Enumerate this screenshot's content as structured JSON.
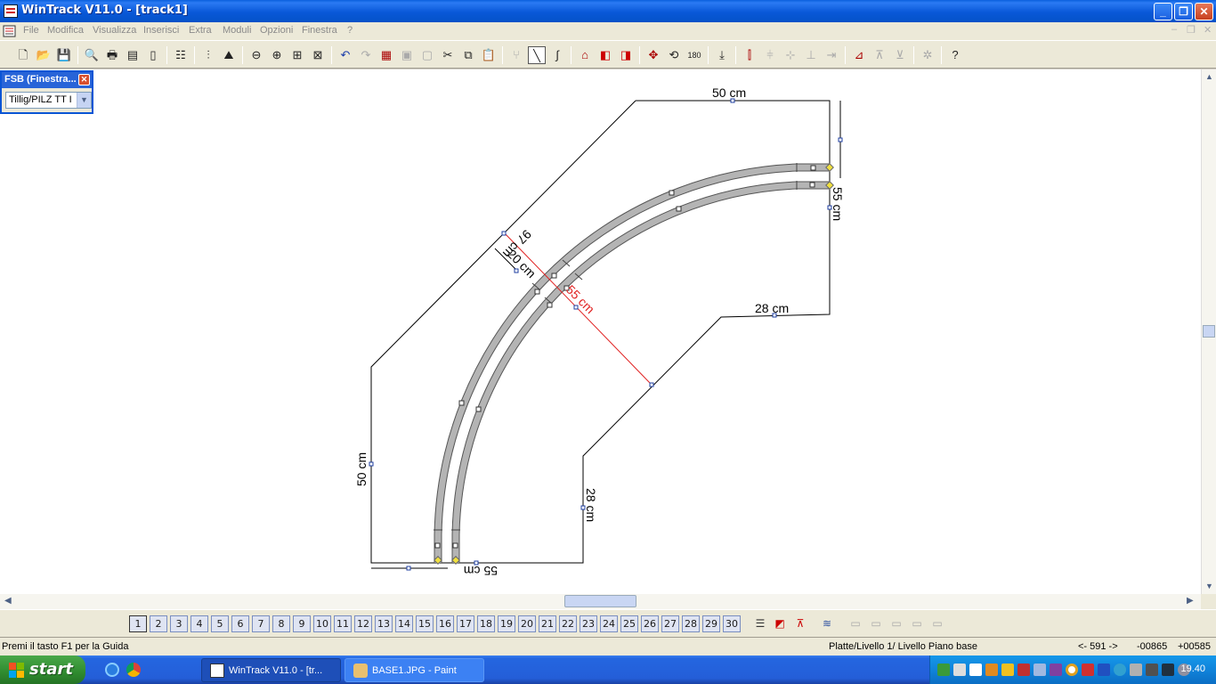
{
  "window": {
    "title": "WinTrack  V11.0 - [track1]"
  },
  "menu": {
    "items": [
      "File",
      "Modifica",
      "Visualizza",
      "Inserisci",
      "Extra",
      "Moduli",
      "Opzioni",
      "Finestra",
      "?"
    ]
  },
  "fsb": {
    "title": "FSB (Finestra...",
    "selected": "Tillig/PILZ  TT I"
  },
  "drawing": {
    "dim_top": "50 cm",
    "dim_right_upper": "55 cm",
    "dim_right_lower": "28 cm",
    "dim_diag_outer": "97 cm",
    "dim_diag_inner": "20 cm",
    "dim_radius": "55 cm",
    "dim_left": "50 cm",
    "dim_bottom_right": "28 cm",
    "dim_bottom": "55 cm",
    "colors": {
      "track": "#b4b4b4",
      "radius_line": "#e02020",
      "outline": "#000000",
      "handle": "#1f3fa0"
    }
  },
  "layers": [
    "1",
    "2",
    "3",
    "4",
    "5",
    "6",
    "7",
    "8",
    "9",
    "10",
    "11",
    "12",
    "13",
    "14",
    "15",
    "16",
    "17",
    "18",
    "19",
    "20",
    "21",
    "22",
    "23",
    "24",
    "25",
    "26",
    "27",
    "28",
    "29",
    "30"
  ],
  "status": {
    "help": "Premi il tasto F1 per la Guida",
    "layer": "Platte/Livello 1/ Livello Piano base",
    "position": "<- 591 ->",
    "x": "-00865",
    "y": "+00585"
  },
  "taskbar": {
    "start": "start",
    "tasks": [
      {
        "label": "WinTrack  V11.0 - [tr...",
        "active": true
      },
      {
        "label": "BASE1.JPG - Paint",
        "active": false
      }
    ],
    "clock": "19.40"
  }
}
